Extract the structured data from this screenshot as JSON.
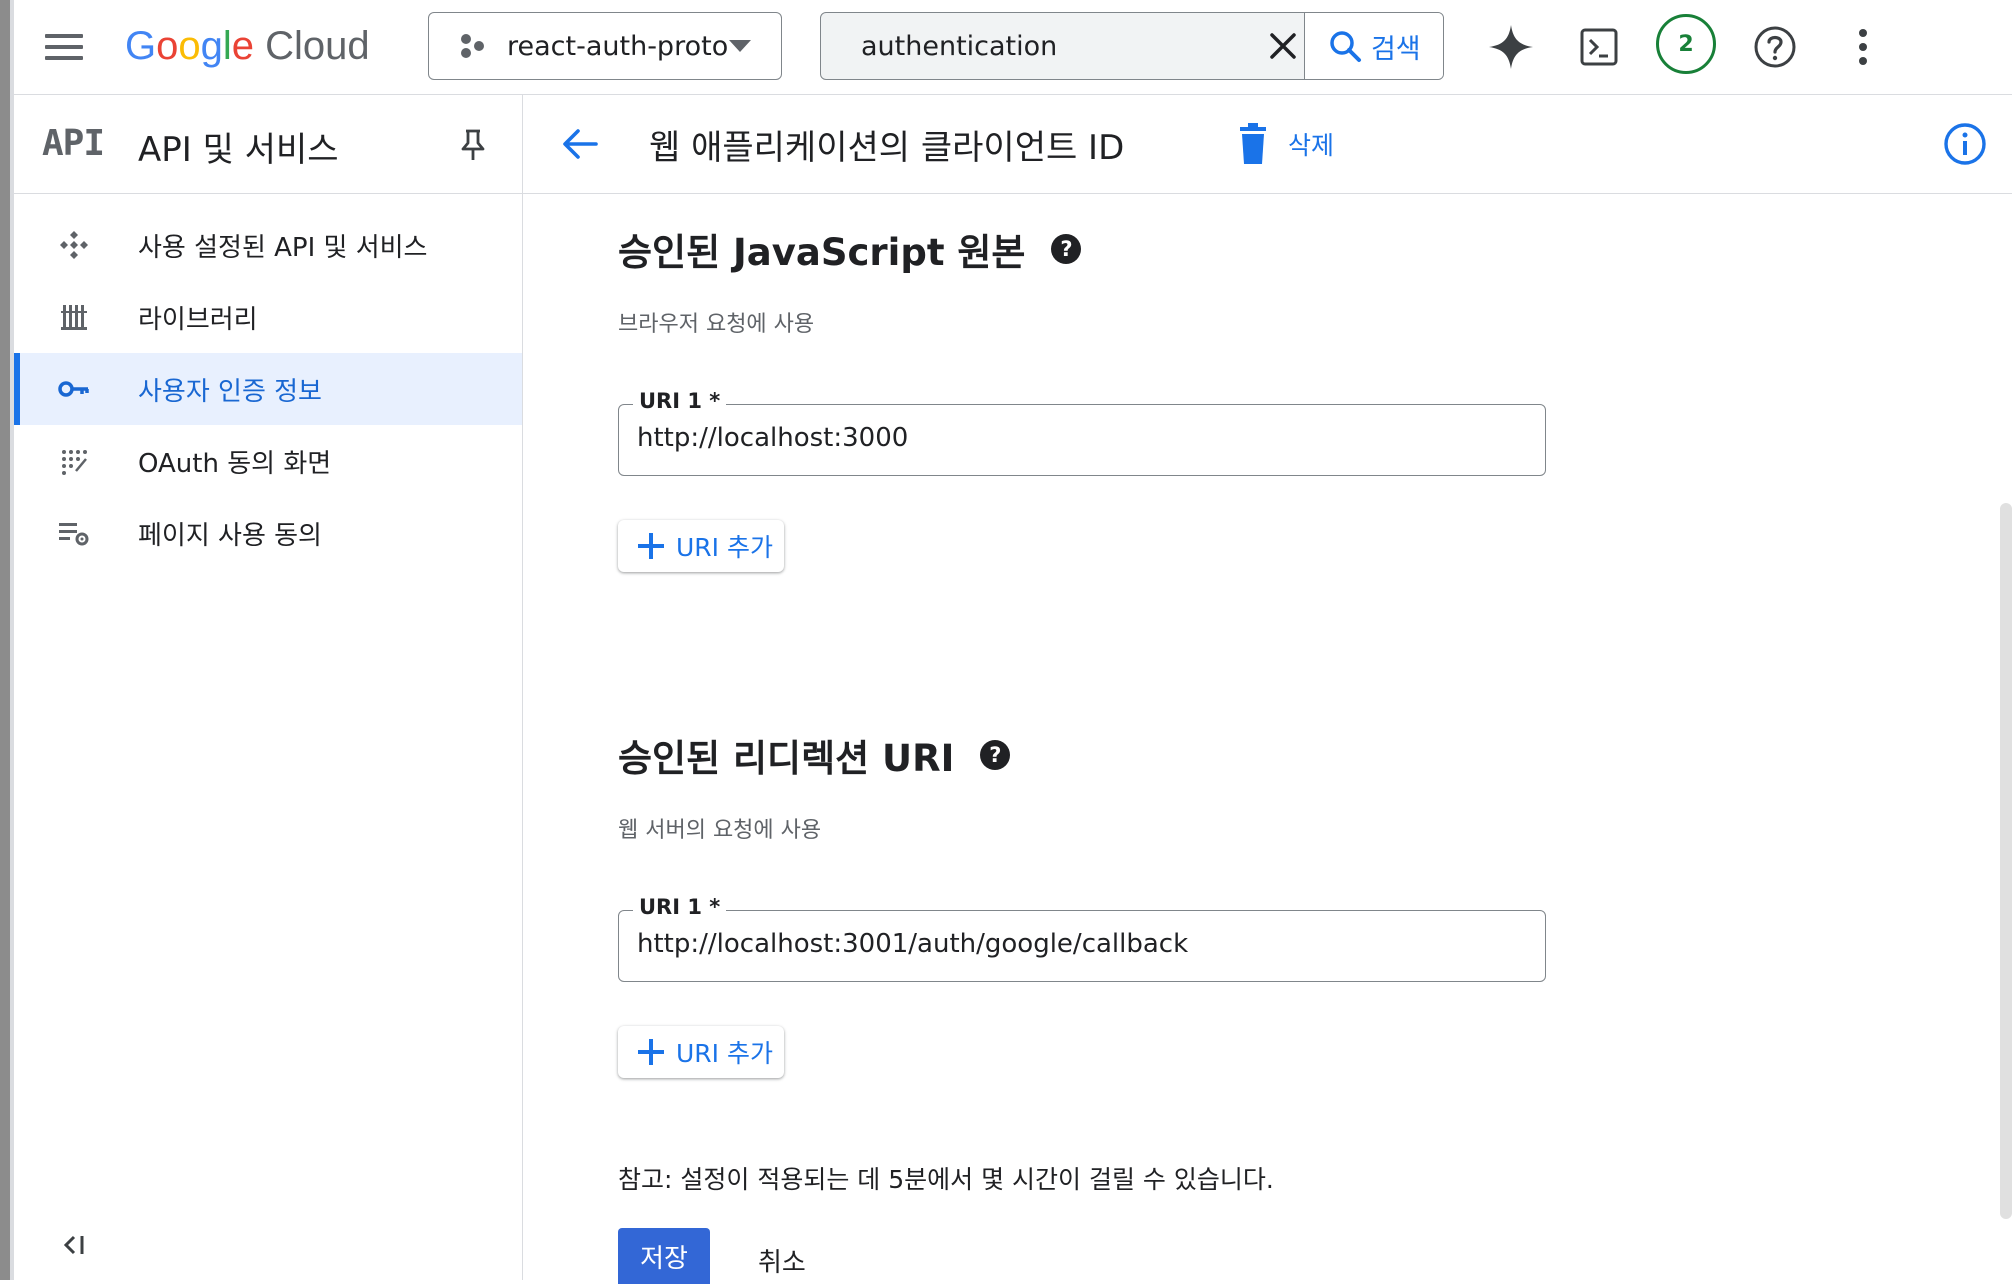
{
  "topbar": {
    "logo_google": "Google",
    "logo_cloud": "Cloud",
    "project_name": "react-auth-proto",
    "search_value": "authentication",
    "search_button": "검색",
    "notification_count": "2"
  },
  "sidebar": {
    "logo": "API",
    "title": "API 및 서비스",
    "items": [
      {
        "label": "사용 설정된 API 및 서비스",
        "icon": "api-diamond-icon"
      },
      {
        "label": "라이브러리",
        "icon": "library-icon"
      },
      {
        "label": "사용자 인증 정보",
        "icon": "key-icon",
        "active": true
      },
      {
        "label": "OAuth 동의 화면",
        "icon": "dots-grid-icon"
      },
      {
        "label": "페이지 사용 동의",
        "icon": "list-settings-icon"
      }
    ]
  },
  "header": {
    "title": "웹 애플리케이션의 클라이언트 ID",
    "delete_label": "삭제"
  },
  "js_origins": {
    "title": "승인된 JavaScript 원본",
    "subtitle": "브라우저 요청에 사용",
    "field_label": "URI 1 *",
    "field_value": "http://localhost:3000",
    "add_label": "URI 추가"
  },
  "redirect_uris": {
    "title": "승인된 리디렉션 URI",
    "subtitle": "웹 서버의 요청에 사용",
    "field_label": "URI 1 *",
    "field_value": "http://localhost:3001/auth/google/callback",
    "add_label": "URI 추가"
  },
  "footer": {
    "note": "참고: 설정이 적용되는 데 5분에서 몇 시간이 걸릴 수 있습니다.",
    "save_label": "저장",
    "cancel_label": "취소"
  },
  "colors": {
    "accent": "#1a73e8",
    "active_bg": "#e8f0fe",
    "badge": "#188038",
    "save_button": "#3367d6"
  }
}
